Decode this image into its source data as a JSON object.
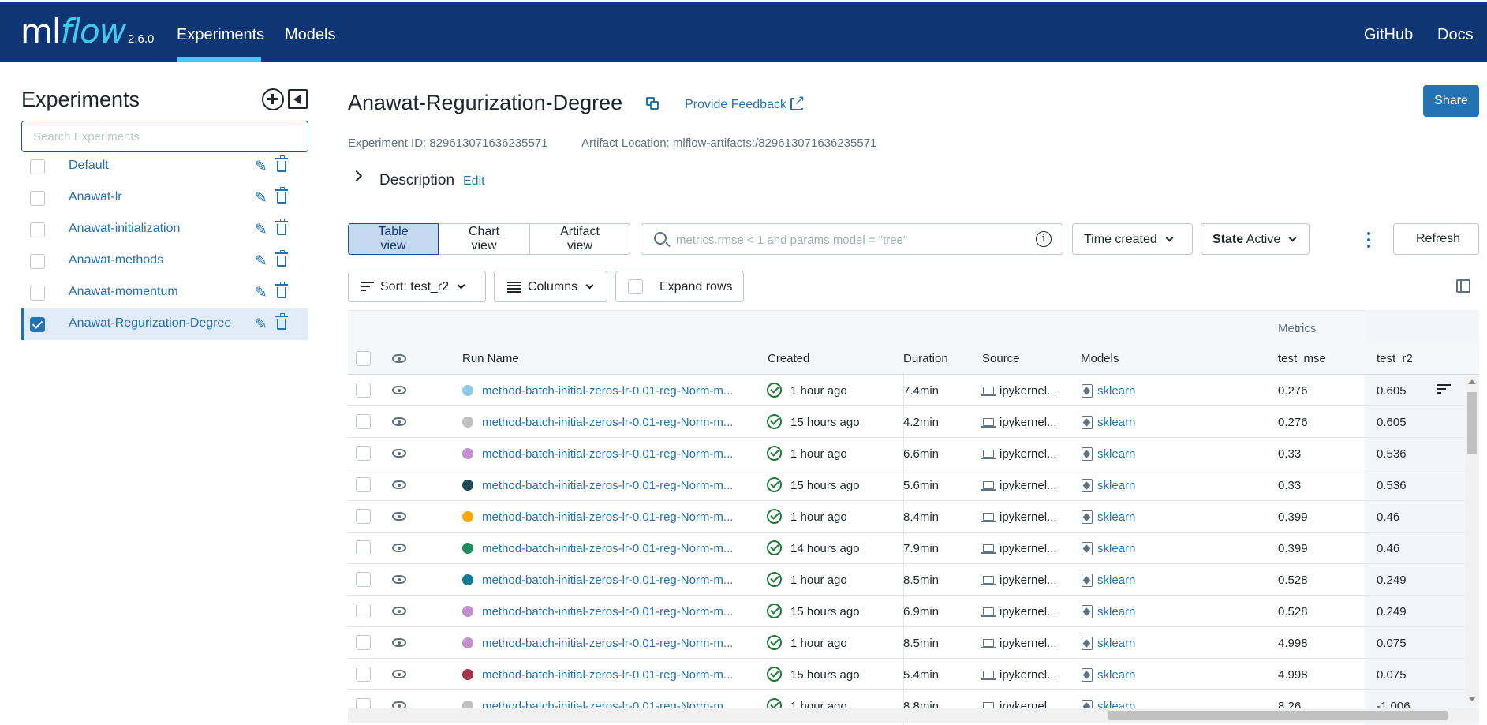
{
  "header": {
    "logo_ml": "ml",
    "logo_flow": "flow",
    "version": "2.6.0",
    "nav": [
      "Experiments",
      "Models"
    ],
    "links": [
      "GitHub",
      "Docs"
    ]
  },
  "sidebar": {
    "title": "Experiments",
    "search_placeholder": "Search Experiments",
    "experiments": [
      {
        "name": "Default",
        "selected": false
      },
      {
        "name": "Anawat-lr",
        "selected": false
      },
      {
        "name": "Anawat-initialization",
        "selected": false
      },
      {
        "name": "Anawat-methods",
        "selected": false
      },
      {
        "name": "Anawat-momentum",
        "selected": false
      },
      {
        "name": "Anawat-Regurization-Degree",
        "selected": true
      }
    ]
  },
  "experiment": {
    "title": "Anawat-Regurization-Degree",
    "feedback": "Provide Feedback",
    "share": "Share",
    "id_text": "Experiment ID: 829613071636235571",
    "artifact_text": "Artifact Location: mlflow-artifacts:/829613071636235571",
    "description": "Description",
    "description_edit": "Edit"
  },
  "toolbar": {
    "views": [
      "Table view",
      "Chart view",
      "Artifact view"
    ],
    "active_view": "Table view",
    "search_placeholder": "metrics.rmse < 1 and params.model = \"tree\"",
    "time_filter": "Time created",
    "state_label": "State",
    "state_value": "Active",
    "refresh": "Refresh",
    "sort": "Sort: test_r2",
    "columns": "Columns",
    "expand_rows": "Expand rows"
  },
  "table": {
    "group_header": "Metrics",
    "headers": {
      "run_name": "Run Name",
      "created": "Created",
      "duration": "Duration",
      "source": "Source",
      "models": "Models",
      "test_mse": "test_mse",
      "test_r2": "test_r2"
    },
    "rows": [
      {
        "color": "#8ecae6",
        "name": "method-batch-initial-zeros-lr-0.01-reg-Norm-m...",
        "created": "1 hour ago",
        "duration": "7.4min",
        "source": "ipykernel...",
        "model": "sklearn",
        "test_mse": "0.276",
        "test_r2": "0.605"
      },
      {
        "color": "#bfbfbf",
        "name": "method-batch-initial-zeros-lr-0.01-reg-Norm-m...",
        "created": "15 hours ago",
        "duration": "4.2min",
        "source": "ipykernel...",
        "model": "sklearn",
        "test_mse": "0.276",
        "test_r2": "0.605"
      },
      {
        "color": "#c48fd0",
        "name": "method-batch-initial-zeros-lr-0.01-reg-Norm-m...",
        "created": "1 hour ago",
        "duration": "6.6min",
        "source": "ipykernel...",
        "model": "sklearn",
        "test_mse": "0.33",
        "test_r2": "0.536"
      },
      {
        "color": "#1e4d5c",
        "name": "method-batch-initial-zeros-lr-0.01-reg-Norm-m...",
        "created": "15 hours ago",
        "duration": "5.6min",
        "source": "ipykernel...",
        "model": "sklearn",
        "test_mse": "0.33",
        "test_r2": "0.536"
      },
      {
        "color": "#f4a905",
        "name": "method-batch-initial-zeros-lr-0.01-reg-Norm-m...",
        "created": "1 hour ago",
        "duration": "8.4min",
        "source": "ipykernel...",
        "model": "sklearn",
        "test_mse": "0.399",
        "test_r2": "0.46"
      },
      {
        "color": "#1e8c5c",
        "name": "method-batch-initial-zeros-lr-0.01-reg-Norm-m...",
        "created": "14 hours ago",
        "duration": "7.9min",
        "source": "ipykernel...",
        "model": "sklearn",
        "test_mse": "0.399",
        "test_r2": "0.46"
      },
      {
        "color": "#157a96",
        "name": "method-batch-initial-zeros-lr-0.01-reg-Norm-m...",
        "created": "1 hour ago",
        "duration": "8.5min",
        "source": "ipykernel...",
        "model": "sklearn",
        "test_mse": "0.528",
        "test_r2": "0.249"
      },
      {
        "color": "#c48fd0",
        "name": "method-batch-initial-zeros-lr-0.01-reg-Norm-m...",
        "created": "15 hours ago",
        "duration": "6.9min",
        "source": "ipykernel...",
        "model": "sklearn",
        "test_mse": "0.528",
        "test_r2": "0.249"
      },
      {
        "color": "#c48fd0",
        "name": "method-batch-initial-zeros-lr-0.01-reg-Norm-m...",
        "created": "1 hour ago",
        "duration": "8.5min",
        "source": "ipykernel...",
        "model": "sklearn",
        "test_mse": "4.998",
        "test_r2": "0.075"
      },
      {
        "color": "#a5344a",
        "name": "method-batch-initial-zeros-lr-0.01-reg-Norm-m...",
        "created": "15 hours ago",
        "duration": "5.4min",
        "source": "ipykernel...",
        "model": "sklearn",
        "test_mse": "4.998",
        "test_r2": "0.075"
      },
      {
        "color": "#bfbfbf",
        "name": "method-batch-initial-zeros-lr-0.01-reg-Norm-m...",
        "created": "1 hour ago",
        "duration": "8.8min",
        "source": "ipykernel...",
        "model": "sklearn",
        "test_mse": "8.26",
        "test_r2": "-1.006"
      }
    ]
  }
}
